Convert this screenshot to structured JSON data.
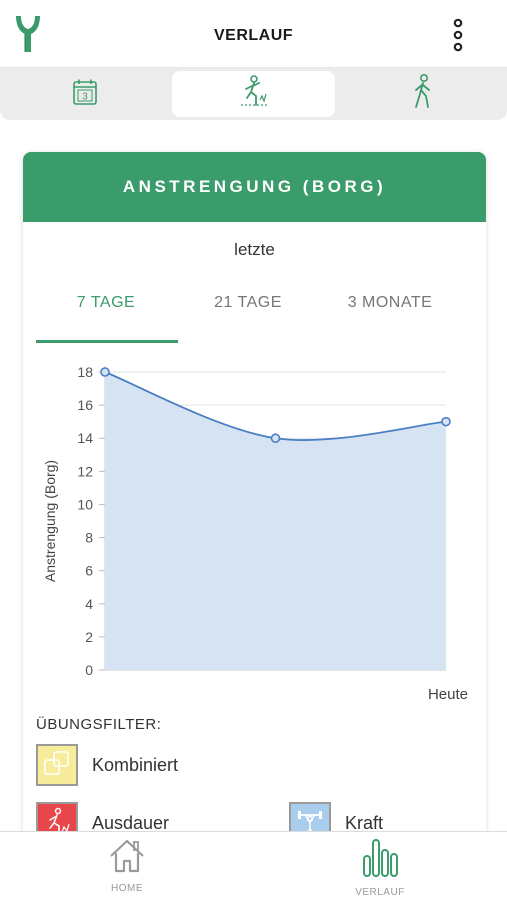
{
  "header": {
    "title": "VERLAUF"
  },
  "view_tabs": [
    {
      "icon": "calendar-icon",
      "label": "3",
      "active": false
    },
    {
      "icon": "exertion-icon",
      "active": true
    },
    {
      "icon": "walking-icon",
      "active": false
    }
  ],
  "card": {
    "title": "ANSTRENGUNG (BORG)",
    "subtitle": "letzte",
    "range_tabs": [
      "7 TAGE",
      "21 TAGE",
      "3 MONATE"
    ],
    "active_range": 0
  },
  "chart_data": {
    "type": "area",
    "x": [
      "",
      "",
      "Heute"
    ],
    "values": [
      18,
      14,
      15
    ],
    "ylabel": "Anstrengung (Borg)",
    "ylim": [
      0,
      18
    ],
    "yticks": [
      0,
      2,
      4,
      6,
      8,
      10,
      12,
      14,
      16,
      18
    ],
    "x_tick_label": "Heute",
    "grid": true,
    "colors": {
      "line": "#4a7fc4",
      "fill": "#d5e3f3"
    }
  },
  "filters": {
    "title": "ÜBUNGSFILTER:",
    "items": [
      {
        "label": "Kombiniert",
        "color": "#f7ec9a",
        "icon": "combined-icon"
      },
      {
        "label": "Ausdauer",
        "color": "#e8464b",
        "icon": "endurance-icon"
      },
      {
        "label": "Kraft",
        "color": "#a9cdec",
        "icon": "strength-icon"
      }
    ]
  },
  "bottom_nav": [
    {
      "label": "HOME",
      "icon": "home-icon",
      "active": false
    },
    {
      "label": "VERLAUF",
      "icon": "bar-chart-icon",
      "active": true
    }
  ],
  "colors": {
    "accent": "#3a9b6b"
  }
}
